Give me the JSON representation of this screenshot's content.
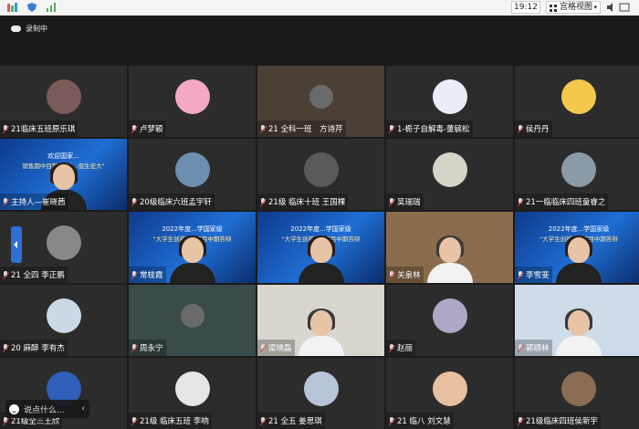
{
  "status": {
    "time": "19:12",
    "view_label": "宫格视图"
  },
  "recording": {
    "label": "录制中"
  },
  "chat": {
    "placeholder": "说点什么..."
  },
  "tiles": [
    {
      "name": "21临床五班原乐琪",
      "kind": "avatar",
      "color": "#7a5a5a"
    },
    {
      "name": "卢梦颖",
      "kind": "avatar",
      "color": "#f3a9c6"
    },
    {
      "name": "21 全科一班　方诗芹",
      "kind": "video",
      "color": "#4a4036"
    },
    {
      "name": "1-栀子自解毒-董毓松",
      "kind": "avatar",
      "color": "#e9eef5"
    },
    {
      "name": "侯丹丹",
      "kind": "avatar",
      "color": "#f4c84a"
    },
    {
      "name": "主持人—崔晓茜",
      "kind": "banner-host",
      "color": "#0e3a8c",
      "host": "主持人"
    },
    {
      "name": "20级临床六班孟宇轩",
      "kind": "avatar",
      "color": "#6c8fb0"
    },
    {
      "name": "21级 临床十班 王国棵",
      "kind": "avatar",
      "color": "#5a5a5a"
    },
    {
      "name": "吴瑞瑞",
      "kind": "avatar",
      "color": "#d8d3c8"
    },
    {
      "name": "21一临临床四班童睿之",
      "kind": "avatar",
      "color": "#8a9aa6"
    },
    {
      "name": "21 全四 李正鹏",
      "kind": "avatar",
      "color": "#888"
    },
    {
      "name": "常桂霞",
      "kind": "banner",
      "color": "#1f6ed4"
    },
    {
      "name": "",
      "kind": "banner",
      "color": "#1f6ed4"
    },
    {
      "name": "关泉林",
      "kind": "office",
      "color": "#8a6b4b"
    },
    {
      "name": "李雪斐",
      "kind": "banner",
      "color": "#1f6ed4"
    },
    {
      "name": "20 麻醉 李有杰",
      "kind": "avatar",
      "color": "#c9d9e6"
    },
    {
      "name": "周永宁",
      "kind": "video",
      "color": "#3b4a4a"
    },
    {
      "name": "梁晓磊",
      "kind": "office",
      "color": "#d9d6cf"
    },
    {
      "name": "赵丽",
      "kind": "avatar",
      "color": "#b0a6c5"
    },
    {
      "name": "郭顺林",
      "kind": "office",
      "color": "#cfdbe8"
    },
    {
      "name": "21级全三王欣",
      "kind": "avatar",
      "color": "#2f5fb8"
    },
    {
      "name": "21级 临床五班 李响",
      "kind": "avatar",
      "color": "#e6e6e6"
    },
    {
      "name": "21 全五 姜思琪",
      "kind": "avatar",
      "color": "#b6c6d8"
    },
    {
      "name": "21 临八 刘文慧",
      "kind": "avatar",
      "color": "#e8c0a0"
    },
    {
      "name": "21级临床四班侯新宇",
      "kind": "avatar",
      "color": "#8a6d54"
    }
  ],
  "banner_text": {
    "line1": "2022年度...学国家级",
    "line2": "\"大学生创新...\" 项目中期答辩"
  },
  "banner_text_left": {
    "line1": "欢迎国家...",
    "line2": "销售圆中目期\"理性...但生宏大\""
  },
  "icons": [
    "record-cloud-icon",
    "microphone-muted-icon",
    "grid-view-icon",
    "emoji-icon",
    "chevron-left-icon"
  ]
}
